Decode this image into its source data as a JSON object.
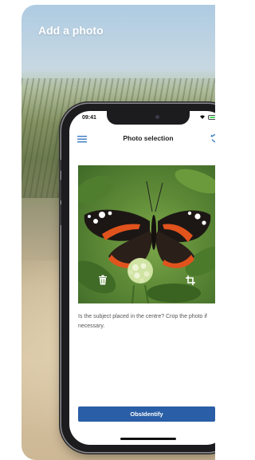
{
  "hero": {
    "title": "Add a photo"
  },
  "status_bar": {
    "time": "09:41"
  },
  "navbar": {
    "title": "Photo selection",
    "menu_icon": "hamburger-menu-icon",
    "undo_icon": "undo-arrow-icon"
  },
  "photo": {
    "subject": "red admiral butterfly on flowers",
    "delete_icon": "trash-icon",
    "crop_icon": "crop-icon"
  },
  "prompt": {
    "text": "Is the subject placed in the centre? Crop the photo if necessary."
  },
  "cta": {
    "label": "ObsIdentify"
  },
  "colors": {
    "brand_blue": "#2a5ea6",
    "icon_blue": "#3b7bc4",
    "screen_bg": "#ffffff"
  }
}
